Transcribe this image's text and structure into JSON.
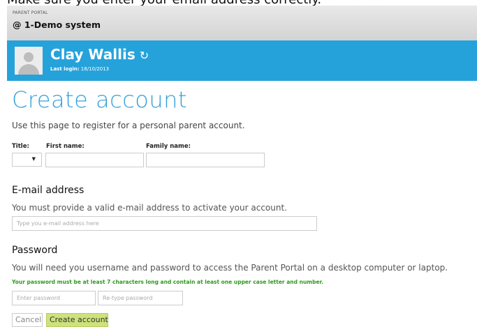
{
  "clipped_heading": "Make sure you enter your email address correctly.",
  "portal": {
    "label": "PARENT PORTAL",
    "school": "@ 1-Demo system"
  },
  "user": {
    "name": "Clay Wallis",
    "refresh_icon": "↻",
    "last_login_label": "Last login:",
    "last_login_value": "18/10/2013"
  },
  "page": {
    "title": "Create account",
    "intro": "Use this page to register for a personal parent account."
  },
  "name_fields": {
    "title_label": "Title:",
    "first_name_label": "First name:",
    "family_name_label": "Family name:",
    "title_selected": "",
    "dropdown_arrow": "▼"
  },
  "email": {
    "heading": "E-mail address",
    "description": "You must provide a valid e-mail address to activate your account.",
    "placeholder": "Type you e-mail address here"
  },
  "password": {
    "heading": "Password",
    "description": "You will need you username and password to access the Parent Portal on a desktop computer or laptop.",
    "rule": "Your password must be at least 7 characters long and contain at least one upper case letter and number.",
    "placeholder": "Enter password",
    "retype_placeholder": "Re-type password"
  },
  "buttons": {
    "cancel": "Cancel",
    "create": "Create account"
  },
  "colors": {
    "accent_blue": "#26a2da",
    "title_blue": "#35a0d9",
    "rule_green": "#2e9a1e",
    "create_button": "#cde27b"
  }
}
